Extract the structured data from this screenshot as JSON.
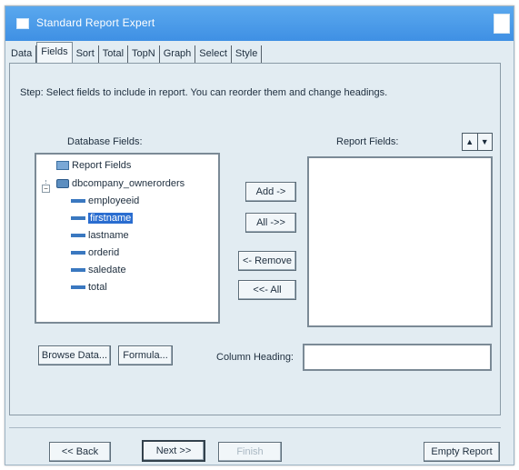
{
  "window": {
    "title": "Standard Report Expert"
  },
  "tabs": [
    {
      "label": "Data"
    },
    {
      "label": "Fields"
    },
    {
      "label": "Sort"
    },
    {
      "label": "Total"
    },
    {
      "label": "TopN"
    },
    {
      "label": "Graph"
    },
    {
      "label": "Select"
    },
    {
      "label": "Style"
    }
  ],
  "active_tab": "Fields",
  "step_text": "Step:  Select fields to include in report.  You can reorder them and change headings.",
  "database_fields": {
    "label": "Database Fields:",
    "tree": [
      {
        "label": "Report Fields",
        "icon": "folder-icon",
        "level": 0
      },
      {
        "label": "dbcompany_ownerorders",
        "icon": "database-icon",
        "level": 0,
        "expanded": true
      },
      {
        "label": "employeeid",
        "icon": "field-icon",
        "level": 1
      },
      {
        "label": "firstname",
        "icon": "field-icon",
        "level": 1,
        "selected": true
      },
      {
        "label": "lastname",
        "icon": "field-icon",
        "level": 1
      },
      {
        "label": "orderid",
        "icon": "field-icon",
        "level": 1
      },
      {
        "label": "saledate",
        "icon": "field-icon",
        "level": 1
      },
      {
        "label": "total",
        "icon": "field-icon",
        "level": 1
      }
    ]
  },
  "report_fields": {
    "label": "Report Fields:",
    "items": []
  },
  "buttons": {
    "add": "Add ->",
    "add_all": "All ->>",
    "remove": "<- Remove",
    "remove_all": "<<- All",
    "browse_data": "Browse Data...",
    "formula": "Formula...",
    "back": "<< Back",
    "next": "Next >>",
    "finish": "Finish",
    "empty_report": "Empty Report"
  },
  "column_heading": {
    "label": "Column Heading:",
    "value": ""
  }
}
